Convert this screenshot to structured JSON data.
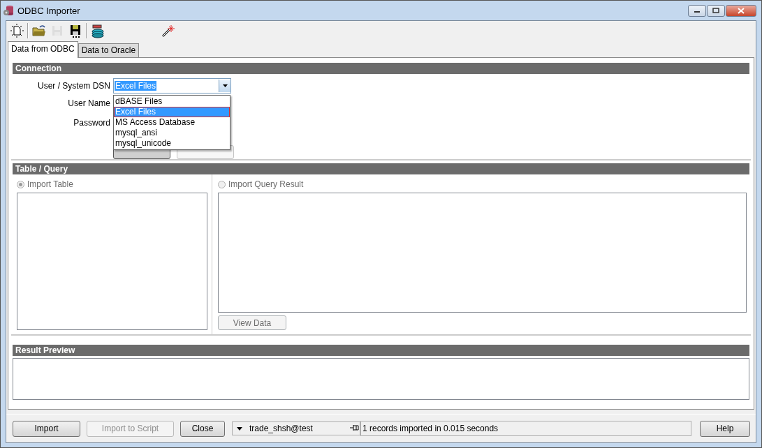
{
  "window": {
    "title": "ODBC Importer"
  },
  "toolbar": [
    {
      "kind": "new",
      "disabled": false
    },
    {
      "kind": "sep"
    },
    {
      "kind": "open",
      "disabled": false
    },
    {
      "kind": "save",
      "disabled": true
    },
    {
      "kind": "saveall",
      "disabled": false
    },
    {
      "kind": "sep"
    },
    {
      "kind": "database",
      "disabled": false
    },
    {
      "kind": "gap"
    },
    {
      "kind": "wand",
      "disabled": false
    }
  ],
  "tabs": [
    {
      "label": "Data from ODBC",
      "selected": true
    },
    {
      "label": "Data to Oracle",
      "selected": false
    }
  ],
  "connection": {
    "title": "Connection",
    "dsn": {
      "label": "User / System DSN",
      "value": "Excel Files"
    },
    "labels": [
      "User Name",
      "Password"
    ],
    "buttons": [
      {
        "disabled": false
      },
      {
        "disabled": true
      }
    ],
    "dropdown": [
      {
        "label": "dBASE Files",
        "selected": false,
        "marked": false
      },
      {
        "label": "Excel Files",
        "selected": true,
        "marked": true
      },
      {
        "label": "MS Access Database",
        "selected": false,
        "marked": false
      },
      {
        "label": "mysql_ansi",
        "selected": false,
        "marked": false
      },
      {
        "label": "mysql_unicode",
        "selected": false,
        "marked": false
      }
    ]
  },
  "table_query": {
    "title": "Table / Query",
    "options": [
      {
        "label": "Import Table",
        "selected": true,
        "disabled": true
      },
      {
        "label": "Import Query Result",
        "selected": false,
        "disabled": true
      }
    ],
    "view_button": {
      "label": "View Data",
      "disabled": true
    }
  },
  "result_preview": {
    "title": "Result Preview"
  },
  "bottom": {
    "buttons": [
      {
        "label": "Import",
        "disabled": false
      },
      {
        "label": "Import to Script",
        "disabled": true
      },
      {
        "label": "Close",
        "disabled": false
      }
    ],
    "connection": "trade_shsh@test",
    "status": "1 records imported in 0.015 seconds",
    "help": {
      "label": "Help",
      "disabled": false
    }
  }
}
